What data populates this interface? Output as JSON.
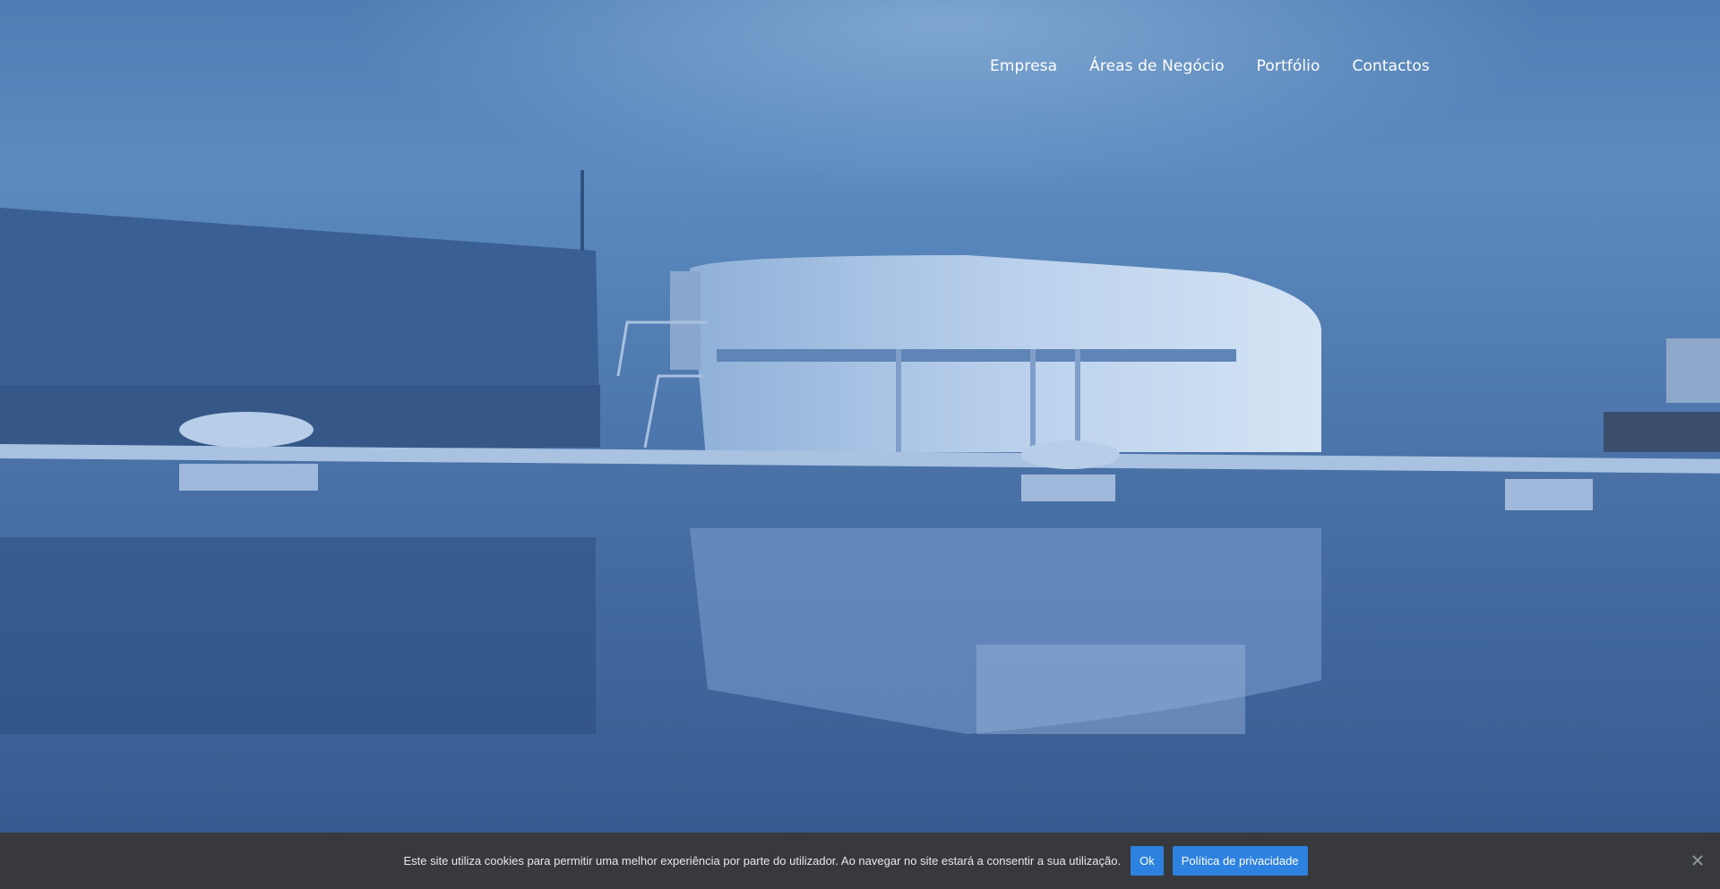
{
  "nav": {
    "items": [
      {
        "label": "Empresa"
      },
      {
        "label": "Áreas de Negócio"
      },
      {
        "label": "Portfólio"
      },
      {
        "label": "Contactos"
      }
    ]
  },
  "cookie": {
    "text": "Este site utiliza cookies para permitir uma melhor experiência por parte do utilizador. Ao navegar no site estará a consentir a sua utilização.",
    "ok_label": "Ok",
    "privacy_label": "Política de privacidade",
    "close_icon": "close-icon"
  },
  "colors": {
    "cookie_bar": "#37393d",
    "button": "#2d82e0",
    "hero_tint": "#3f6aa2"
  }
}
